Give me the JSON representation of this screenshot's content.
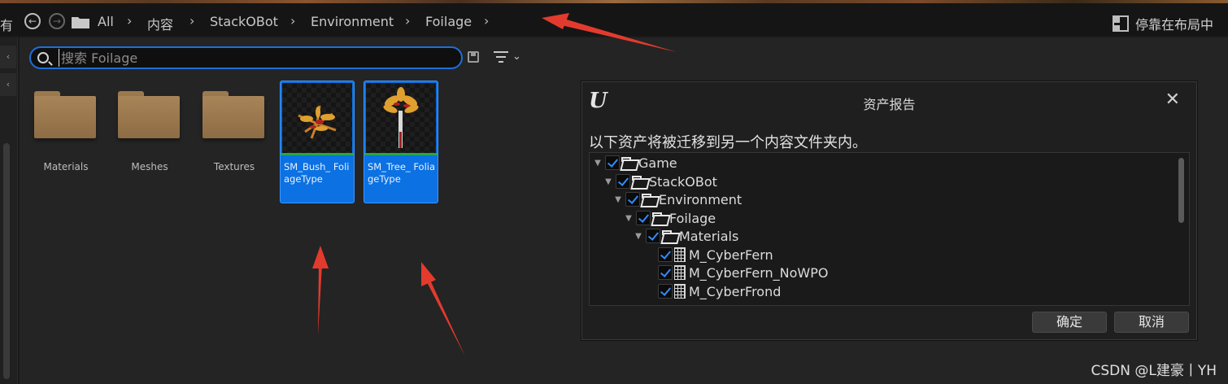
{
  "toolbar": {
    "cut_left_text": "有",
    "breadcrumbs": [
      "All",
      "内容",
      "StackOBot",
      "Environment",
      "Foilage"
    ],
    "dock_label": "停靠在布局中"
  },
  "search": {
    "placeholder": "搜索 Foilage",
    "value": ""
  },
  "folders": [
    {
      "label": "Materials"
    },
    {
      "label": "Meshes"
    },
    {
      "label": "Textures"
    }
  ],
  "assets": [
    {
      "label": "SM_Bush_ FoliageType"
    },
    {
      "label": "SM_Tree_ FoliageType"
    }
  ],
  "dialog": {
    "title": "资产报告",
    "message": "以下资产将被迁移到另一个内容文件夹内。",
    "tree": [
      {
        "label": "Game",
        "type": "folder",
        "expanded": true,
        "checked": true
      },
      {
        "label": "StackOBot",
        "type": "folder",
        "expanded": true,
        "checked": true
      },
      {
        "label": "Environment",
        "type": "folder",
        "expanded": true,
        "checked": true
      },
      {
        "label": "Foilage",
        "type": "folder",
        "expanded": true,
        "checked": true
      },
      {
        "label": "Materials",
        "type": "folder",
        "expanded": true,
        "checked": true
      },
      {
        "label": "M_CyberFern",
        "type": "material",
        "checked": true
      },
      {
        "label": "M_CyberFern_NoWPO",
        "type": "material",
        "checked": true
      },
      {
        "label": "M_CyberFrond",
        "type": "material",
        "checked": true
      }
    ],
    "confirm_label": "确定",
    "cancel_label": "取消"
  },
  "watermark": "CSDN @L建豪丨YH",
  "colors": {
    "accent": "#0c71e2",
    "checkmark": "#2f8cff",
    "annotation_arrow": "#e23b2e"
  }
}
